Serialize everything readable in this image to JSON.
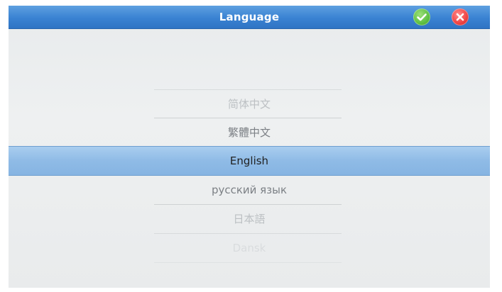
{
  "window": {
    "title": "Language",
    "confirm_icon": "check-icon",
    "cancel_icon": "close-icon"
  },
  "colors": {
    "title_bar": "#3a82d2",
    "selected_row": "#8fbbe6",
    "confirm": "#61c145",
    "cancel": "#f04646"
  },
  "languages": [
    {
      "label": "简体中文",
      "state": "faded"
    },
    {
      "label": "繁體中文",
      "state": "normal"
    },
    {
      "label": "English",
      "state": "selected"
    },
    {
      "label": "русский язык",
      "state": "normal"
    },
    {
      "label": "日本語",
      "state": "faded"
    },
    {
      "label": "Dansk",
      "state": "very-faded"
    }
  ]
}
